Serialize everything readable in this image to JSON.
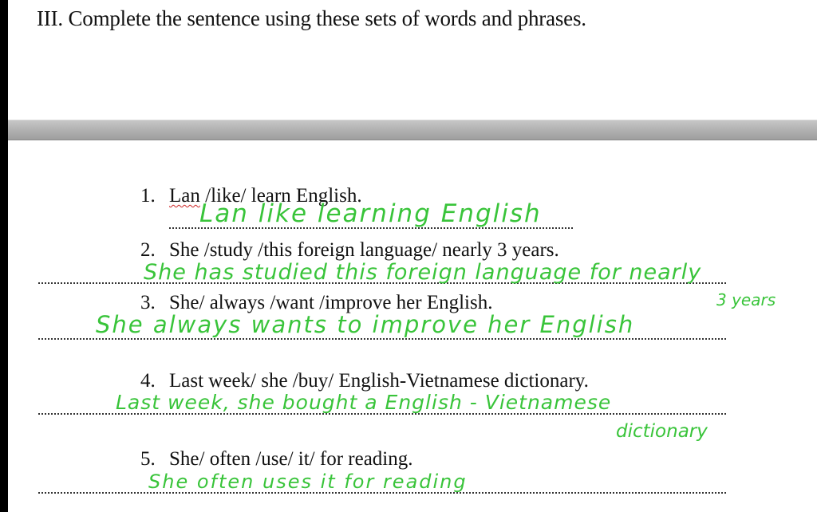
{
  "heading": "III. Complete the sentence using these sets of words and phrases.",
  "items": [
    {
      "number": "1.",
      "prompt_first_word": "Lan",
      "prompt_rest": " /like/ learn English.",
      "answer": "Lan like learning English"
    },
    {
      "number": "2.",
      "prompt": "She /study /this foreign language/ nearly 3 years.",
      "answer": "She has studied this foreign language for nearly",
      "answer_extra": "3 years"
    },
    {
      "number": "3.",
      "prompt": "She/ always /want /improve her English.",
      "answer": "She always wants to improve her English"
    },
    {
      "number": "4.",
      "prompt": "Last week/ she /buy/ English-Vietnamese dictionary.",
      "answer": "Last week, she bought a English - Vietnamese",
      "answer_extra": "dictionary"
    },
    {
      "number": "5.",
      "prompt": "She/ often /use/ it/ for reading.",
      "answer": "She often uses it for reading"
    }
  ],
  "colors": {
    "handwriting": "#39c43a",
    "page_gap": "#b3b3b3"
  }
}
